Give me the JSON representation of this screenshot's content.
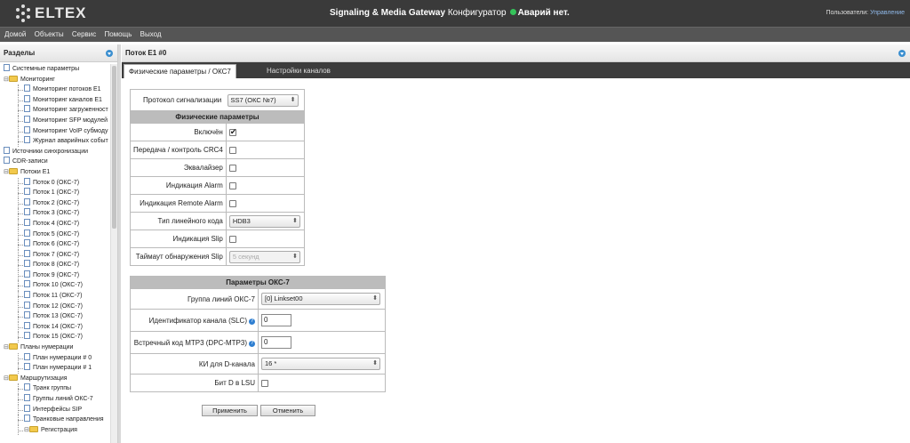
{
  "header": {
    "logo_text": "ELTEX",
    "title_bold": "Signaling & Media Gateway",
    "title_rest": "Конфигуратор",
    "alarm_text": "Аварий нет.",
    "users_label": "Пользователи:",
    "users_link": "Управление"
  },
  "menu": [
    "Домой",
    "Объекты",
    "Сервис",
    "Помощь",
    "Выход"
  ],
  "left": {
    "title": "Разделы",
    "tree": [
      {
        "label": "Системные параметры",
        "level": 1,
        "kind": "doc"
      },
      {
        "label": "Мониторинг",
        "level": 1,
        "kind": "folder",
        "toggle": "⊟"
      },
      {
        "label": "Мониторинг потоков E1",
        "level": 2,
        "kind": "doc"
      },
      {
        "label": "Мониторинг каналов E1",
        "level": 2,
        "kind": "doc"
      },
      {
        "label": "Мониторинг загруженност",
        "level": 2,
        "kind": "doc"
      },
      {
        "label": "Мониторинг SFP модулей",
        "level": 2,
        "kind": "doc"
      },
      {
        "label": "Мониторинг VoIP субмоду",
        "level": 2,
        "kind": "doc"
      },
      {
        "label": "Журнал аварийных событ",
        "level": 2,
        "kind": "doc"
      },
      {
        "label": "Источники синхронизации",
        "level": 1,
        "kind": "doc"
      },
      {
        "label": "CDR-записи",
        "level": 1,
        "kind": "doc"
      },
      {
        "label": "Потоки E1",
        "level": 1,
        "kind": "folder",
        "toggle": "⊟"
      },
      {
        "label": "Поток 0 (ОКС-7)",
        "level": 2,
        "kind": "doc"
      },
      {
        "label": "Поток 1 (ОКС-7)",
        "level": 2,
        "kind": "doc"
      },
      {
        "label": "Поток 2 (ОКС-7)",
        "level": 2,
        "kind": "doc"
      },
      {
        "label": "Поток 3 (ОКС-7)",
        "level": 2,
        "kind": "doc"
      },
      {
        "label": "Поток 4 (ОКС-7)",
        "level": 2,
        "kind": "doc"
      },
      {
        "label": "Поток 5 (ОКС-7)",
        "level": 2,
        "kind": "doc"
      },
      {
        "label": "Поток 6 (ОКС-7)",
        "level": 2,
        "kind": "doc"
      },
      {
        "label": "Поток 7 (ОКС-7)",
        "level": 2,
        "kind": "doc"
      },
      {
        "label": "Поток 8 (ОКС-7)",
        "level": 2,
        "kind": "doc"
      },
      {
        "label": "Поток 9 (ОКС-7)",
        "level": 2,
        "kind": "doc"
      },
      {
        "label": "Поток 10 (ОКС-7)",
        "level": 2,
        "kind": "doc"
      },
      {
        "label": "Поток 11 (ОКС-7)",
        "level": 2,
        "kind": "doc"
      },
      {
        "label": "Поток 12 (ОКС-7)",
        "level": 2,
        "kind": "doc"
      },
      {
        "label": "Поток 13 (ОКС-7)",
        "level": 2,
        "kind": "doc"
      },
      {
        "label": "Поток 14 (ОКС-7)",
        "level": 2,
        "kind": "doc"
      },
      {
        "label": "Поток 15 (ОКС-7)",
        "level": 2,
        "kind": "doc"
      },
      {
        "label": "Планы нумерации",
        "level": 1,
        "kind": "folder",
        "toggle": "⊟"
      },
      {
        "label": "План нумерации # 0",
        "level": 2,
        "kind": "doc"
      },
      {
        "label": "План нумерации # 1",
        "level": 2,
        "kind": "doc"
      },
      {
        "label": "Маршрутизация",
        "level": 1,
        "kind": "folder",
        "toggle": "⊟"
      },
      {
        "label": "Транк группы",
        "level": 2,
        "kind": "doc"
      },
      {
        "label": "Группы линий ОКС-7",
        "level": 2,
        "kind": "doc"
      },
      {
        "label": "Интерфейсы SIP",
        "level": 2,
        "kind": "doc"
      },
      {
        "label": "Транковые направления",
        "level": 2,
        "kind": "doc"
      },
      {
        "label": "Регистрация",
        "level": 2,
        "kind": "folder",
        "toggle": "⊟"
      }
    ]
  },
  "right": {
    "title": "Поток E1 #0",
    "tabs": [
      "Физические параметры / ОКС7",
      "Настройки каналов"
    ],
    "physical": {
      "protocol_label": "Протокол сигнализации",
      "protocol_value": "SS7 (ОКС №7)",
      "section_title": "Физические параметры",
      "enabled_label": "Включён",
      "enabled_checked": true,
      "crc4_label": "Передача / контроль CRC4",
      "crc4_checked": false,
      "equalizer_label": "Эквалайзер",
      "equalizer_checked": false,
      "alarm_label": "Индикация Alarm",
      "alarm_checked": false,
      "remote_alarm_label": "Индикация Remote Alarm",
      "remote_alarm_checked": false,
      "line_code_label": "Тип линейного кода",
      "line_code_value": "HDB3",
      "slip_label": "Индикация Slip",
      "slip_checked": false,
      "slip_timeout_label": "Таймаут обнаружения Slip",
      "slip_timeout_value": "5 секунд"
    },
    "oks7": {
      "section_title": "Параметры ОКС-7",
      "linegroup_label": "Группа линий ОКС-7",
      "linegroup_value": "[0] Linkset00",
      "slc_label": "Идентификатор канала (SLC)",
      "slc_value": "0",
      "dpc_label": "Встречный код MTP3 (DPC-MTP3)",
      "dpc_value": "0",
      "ki_label": "КИ для D-канала",
      "ki_value": "16 *",
      "bitd_label": "Бит D в LSU",
      "bitd_checked": false
    },
    "apply_label": "Применить",
    "cancel_label": "Отменить"
  },
  "colors": {
    "topbar": "#3a3a3a",
    "menubar": "#555555",
    "accent_blue": "#3b8fd0",
    "alarm_ok": "#35c35a",
    "section_header": "#bcbcbc"
  }
}
